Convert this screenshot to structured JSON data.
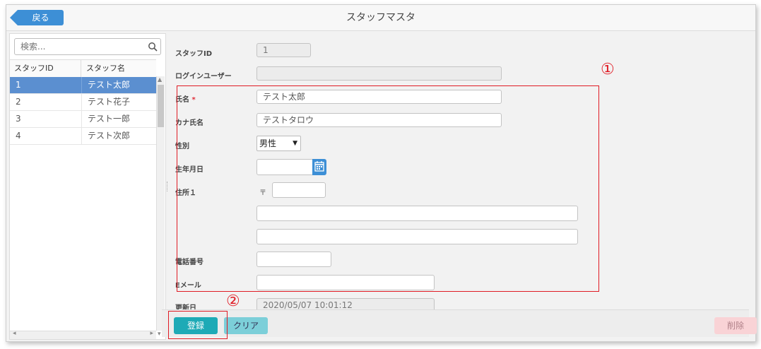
{
  "header": {
    "back_label": "戻る",
    "title": "スタッフマスタ"
  },
  "sidebar": {
    "search_placeholder": "検索...",
    "columns": [
      "スタッフID",
      "スタッフ名"
    ],
    "rows": [
      {
        "id": "1",
        "name": "テスト太郎",
        "selected": true
      },
      {
        "id": "2",
        "name": "テスト花子",
        "selected": false
      },
      {
        "id": "3",
        "name": "テスト一郎",
        "selected": false
      },
      {
        "id": "4",
        "name": "テスト次郎",
        "selected": false
      }
    ]
  },
  "form": {
    "staff_id": {
      "label": "スタッフID",
      "value": "1"
    },
    "login_user": {
      "label": "ログインユーザー",
      "value": ""
    },
    "name": {
      "label": "氏名",
      "required_mark": "*",
      "value": "テスト太郎"
    },
    "kana_name": {
      "label": "カナ氏名",
      "value": "テストタロウ"
    },
    "gender": {
      "label": "性別",
      "value": "男性"
    },
    "birthdate": {
      "label": "生年月日",
      "value": ""
    },
    "address": {
      "label": "住所１",
      "zip_mark": "〒",
      "zip": "",
      "line1": "",
      "line2": ""
    },
    "phone": {
      "label": "電話番号",
      "value": ""
    },
    "email": {
      "label": "Eメール",
      "value": ""
    },
    "updated": {
      "label": "更新日",
      "value": "2020/05/07 10:01:12"
    }
  },
  "footer": {
    "register_label": "登録",
    "clear_label": "クリア",
    "delete_label": "削除"
  },
  "annotations": {
    "marker1": "①",
    "marker2": "②"
  },
  "colors": {
    "accent": "#3d8fd6",
    "selected_row": "#5b8fd0",
    "register": "#1eaab6",
    "annotation": "#e01b24"
  }
}
